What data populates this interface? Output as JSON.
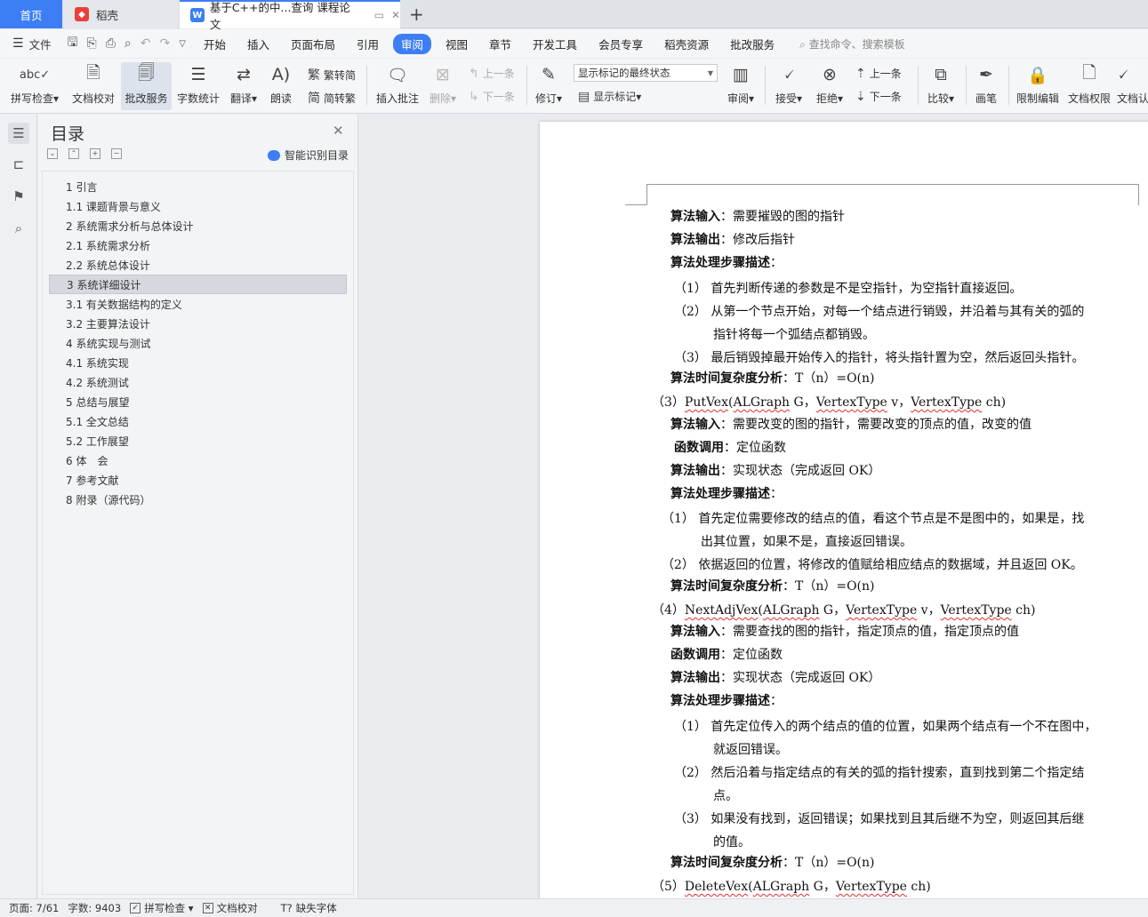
{
  "tabs": {
    "home": "首页",
    "daoke": "稻壳",
    "doc": "基于C++的中...查询 课程论文"
  },
  "menu": {
    "file": "文件",
    "items": [
      "开始",
      "插入",
      "页面布局",
      "引用",
      "审阅",
      "视图",
      "章节",
      "开发工具",
      "会员专享",
      "稻壳资源",
      "批改服务"
    ],
    "active": "审阅",
    "search": "查找命令、搜索模板"
  },
  "ribbon": {
    "spell": "拼写检查",
    "proof": "文档校对",
    "review_service": "批改服务",
    "word_count": "字数统计",
    "translate": "翻译",
    "read_aloud": "朗读",
    "trad_to_simp": "繁转简",
    "simp_to_trad": "简转繁",
    "insert_comment": "插入批注",
    "delete": "删除",
    "prev_comment": "上一条",
    "next_comment": "下一条",
    "track": "修订",
    "markup_state": "显示标记的最终状态",
    "show_markup": "显示标记",
    "review_pane": "审阅",
    "accept": "接受",
    "reject": "拒绝",
    "prev_change": "上一条",
    "next_change": "下一条",
    "compare": "比较",
    "pen": "画笔",
    "restrict": "限制编辑",
    "doc_rights": "文档权限",
    "doc_cert": "文档认"
  },
  "toc": {
    "title": "目录",
    "smart": "智能识别目录",
    "items": [
      "1 引言",
      "1.1 课题背景与意义",
      "2 系统需求分析与总体设计",
      "2.1 系统需求分析",
      "2.2 系统总体设计",
      "3 系统详细设计",
      "3.1 有关数据结构的定义",
      "3.2 主要算法设计",
      "4 系统实现与测试",
      "4.1 系统实现",
      "4.2 系统测试",
      "5 总结与展望",
      "5.1 全文总结",
      "5.2 工作展望",
      "6 体　会",
      "7 参考文献",
      "8 附录（源代码）"
    ],
    "selected_index": 5
  },
  "doc": {
    "l01_b": "算法输入",
    "l01_t": "：需要摧毁的图的指针",
    "l02_b": "算法输出",
    "l02_t": "：修改后指针",
    "l03_b": "算法处理步骤描述",
    "l03_t": "：",
    "l04": "（1）  首先判断传递的参数是不是空指针，为空指针直接返回。",
    "l05": "（2）  从第一个节点开始，对每一个结点进行销毁，并沿着与其有关的弧的",
    "l06": "指针将每一个弧结点都销毁。",
    "l07": "（3）  最后销毁掉最开始传入的指针，将头指针置为空，然后返回头指针。",
    "l08_b": "算法时间复杂度分析",
    "l08_t": "：T（n）=O(n)",
    "l09_a": "（3）",
    "l09_f": "PutVex",
    "l09_p": "(",
    "l09_g": "ALGraph",
    "l09_q": " G，",
    "l09_v": "VertexType",
    "l09_r": " v，",
    "l09_v2": "VertexType",
    "l09_s": " ch)",
    "l10_b": "算法输入",
    "l10_t": "：需要改变的图的指针，需要改变的顶点的值，改变的值",
    "l11_b": "函数调用",
    "l11_t": "：定位函数",
    "l12_b": "算法输出",
    "l12_t": "：实现状态（完成返回 OK）",
    "l13_b": "算法处理步骤描述",
    "l13_t": "：",
    "l14": "（1）  首先定位需要修改的结点的值，看这个节点是不是图中的，如果是，找",
    "l15": "出其位置，如果不是，直接返回错误。",
    "l16": "（2）  依据返回的位置，将修改的值赋给相应结点的数据域，并且返回 OK。",
    "l17_b": "算法时间复杂度分析",
    "l17_t": "：T（n）=O(n)",
    "l18_a": "（4）",
    "l18_f": "NextAdjVex",
    "l18_p": "(",
    "l18_g": "ALGraph",
    "l18_q": " G，",
    "l18_v": "VertexType",
    "l18_r": " v，",
    "l18_v2": "VertexType",
    "l18_s": " ch)",
    "l19_b": "算法输入",
    "l19_t": "：需要查找的图的指针，指定顶点的值，指定顶点的值",
    "l20_b": "函数调用",
    "l20_t": "：定位函数",
    "l21_b": "算法输出",
    "l21_t": "：实现状态（完成返回 OK）",
    "l22_b": "算法处理步骤描述",
    "l22_t": "：",
    "l23": "（1）  首先定位传入的两个结点的值的位置，如果两个结点有一个不在图中，",
    "l24": "就返回错误。",
    "l25": "（2）  然后沿着与指定结点的有关的弧的指针搜索，直到找到第二个指定结",
    "l26": "点。",
    "l27": "（3）  如果没有找到，返回错误；如果找到且其后继不为空，则返回其后继",
    "l28": "的值。",
    "l29_b": "算法时间复杂度分析",
    "l29_t": "：T（n）=O(n)",
    "l30_a": "（5）",
    "l30_f": "DeleteVex",
    "l30_p": "(",
    "l30_g": "ALGraph",
    "l30_q": " G，",
    "l30_v": "VertexType",
    "l30_s": " ch)"
  },
  "status": {
    "page": "页面: 7/61",
    "words": "字数: 9403",
    "spell": "拼写检查",
    "proof": "文档校对",
    "missing_font": "缺失字体"
  }
}
